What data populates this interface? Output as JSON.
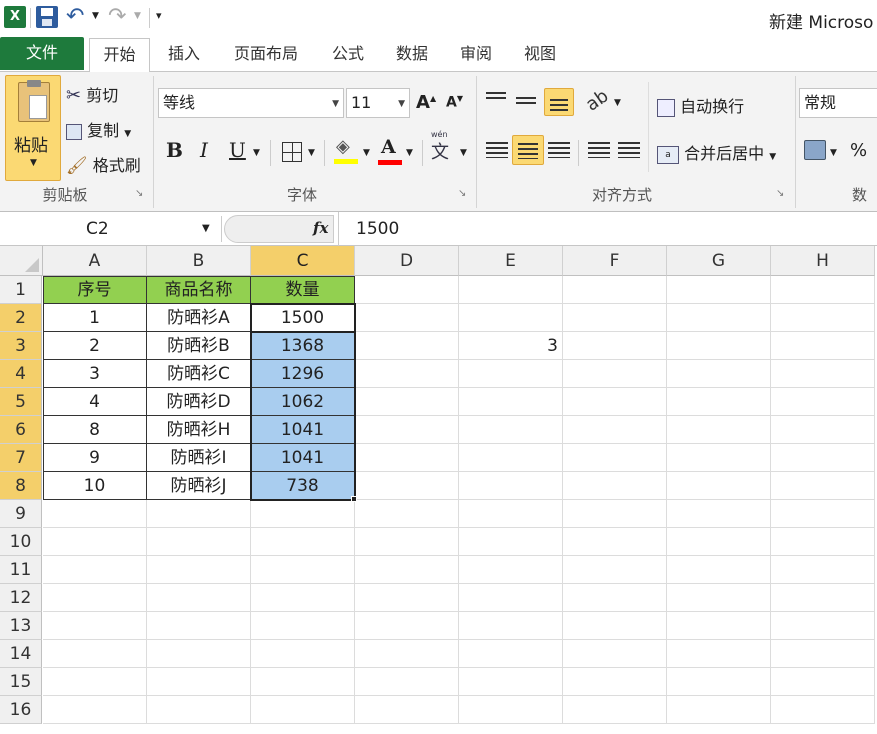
{
  "app": {
    "window_title": "新建 Microso"
  },
  "tabs": [
    {
      "label": "文件"
    },
    {
      "label": "开始"
    },
    {
      "label": "插入"
    },
    {
      "label": "页面布局"
    },
    {
      "label": "公式"
    },
    {
      "label": "数据"
    },
    {
      "label": "审阅"
    },
    {
      "label": "视图"
    }
  ],
  "clipboard": {
    "paste": "粘贴",
    "cut": "剪切",
    "copy": "复制",
    "format_painter": "格式刷",
    "group_label": "剪贴板"
  },
  "font": {
    "name": "等线",
    "size": "11",
    "bold": "B",
    "italic": "I",
    "underline": "U",
    "group_label": "字体"
  },
  "alignment": {
    "wrap_text": "自动换行",
    "merge_center": "合并后居中",
    "group_label": "对齐方式"
  },
  "number": {
    "format": "常规",
    "percent": "%",
    "group_label": "数"
  },
  "formula_bar": {
    "name_box": "C2",
    "fx": "fx",
    "value": "1500"
  },
  "sheet": {
    "columns": [
      "A",
      "B",
      "C",
      "D",
      "E",
      "F",
      "G",
      "H"
    ],
    "rows": [
      "1",
      "2",
      "3",
      "4",
      "5",
      "6",
      "7",
      "8",
      "9",
      "10",
      "11",
      "12",
      "13",
      "14",
      "15",
      "16"
    ],
    "header": {
      "a": "序号",
      "b": "商品名称",
      "c": "数量"
    },
    "data": [
      {
        "a": "1",
        "b": "防晒衫A",
        "c": "1500"
      },
      {
        "a": "2",
        "b": "防晒衫B",
        "c": "1368"
      },
      {
        "a": "3",
        "b": "防晒衫C",
        "c": "1296"
      },
      {
        "a": "4",
        "b": "防晒衫D",
        "c": "1062"
      },
      {
        "a": "8",
        "b": "防晒衫H",
        "c": "1041"
      },
      {
        "a": "9",
        "b": "防晒衫I",
        "c": "1041"
      },
      {
        "a": "10",
        "b": "防晒衫J",
        "c": "738"
      }
    ],
    "e3": "3",
    "active_cell": "C2"
  },
  "colors": {
    "file_tab": "#1e7a3c",
    "header_fill": "#92d050",
    "selection_fill": "#a9cdef",
    "selected_header": "#f4cf6a"
  }
}
